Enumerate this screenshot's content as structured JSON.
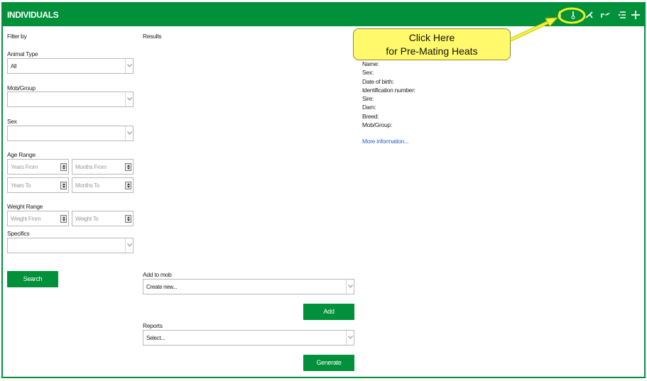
{
  "header": {
    "title": "INDIVIDUALS",
    "icons": [
      "filter-icon",
      "thermometer-icon",
      "mating-icon",
      "birth-icon",
      "list-icon",
      "plus-icon"
    ]
  },
  "filter": {
    "heading": "Filter by",
    "animal_type": {
      "label": "Animal Type",
      "value": "All"
    },
    "mob_group": {
      "label": "Mob/Group",
      "value": ""
    },
    "sex": {
      "label": "Sex",
      "value": ""
    },
    "age_range": {
      "label": "Age Range",
      "years_from": "Years From",
      "months_from": "Months From",
      "years_to": "Years To",
      "months_to": "Months To"
    },
    "weight_range": {
      "label": "Weight Range",
      "weight_from": "Weight From",
      "weight_to": "Weight To"
    },
    "specifics": {
      "label": "Specifics",
      "value": ""
    },
    "search_label": "Search"
  },
  "results": {
    "heading": "Results",
    "add_to_mob": {
      "label": "Add to mob",
      "value": "Create new..."
    },
    "add_label": "Add",
    "reports": {
      "label": "Reports",
      "value": "Select..."
    },
    "generate_label": "Generate"
  },
  "details": {
    "fields": [
      "Name:",
      "Sex:",
      "Date of birth:",
      "Identification number:",
      "Sire:",
      "Dam:",
      "Breed:",
      "Mob/Group:"
    ],
    "more_info": "More information..."
  },
  "callout": {
    "line1": "Click Here",
    "line2": "for Pre-Mating Heats",
    "color": "#fff96b"
  },
  "colors": {
    "brand_green": "#00913a",
    "link_blue": "#2a62c9",
    "callout_ring": "#f2ef1f"
  }
}
